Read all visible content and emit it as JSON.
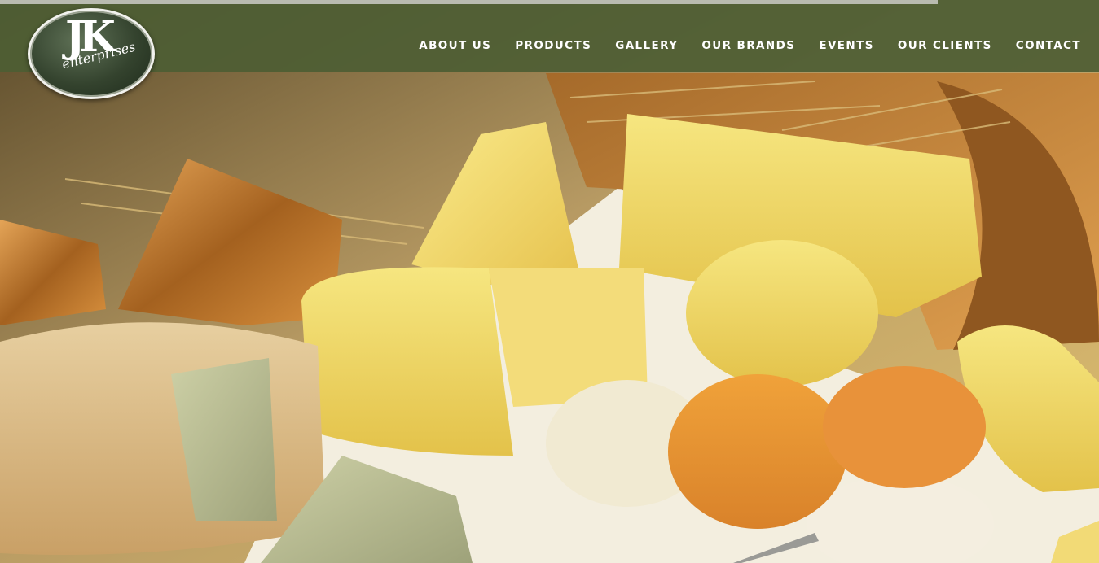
{
  "logo": {
    "initials": "JK",
    "subtitle": "enterprises"
  },
  "nav": {
    "items": [
      {
        "label": "ABOUT US"
      },
      {
        "label": "PRODUCTS"
      },
      {
        "label": "GALLERY"
      },
      {
        "label": "OUR BRANDS"
      },
      {
        "label": "EVENTS"
      },
      {
        "label": "OUR CLIENTS"
      },
      {
        "label": "CONTACT"
      }
    ]
  },
  "colors": {
    "header_bg": "#4d5e34",
    "nav_text": "#ffffff",
    "progress_line": "#b9bbb0"
  },
  "hero": {
    "image": "cheese-assortment-photo"
  }
}
